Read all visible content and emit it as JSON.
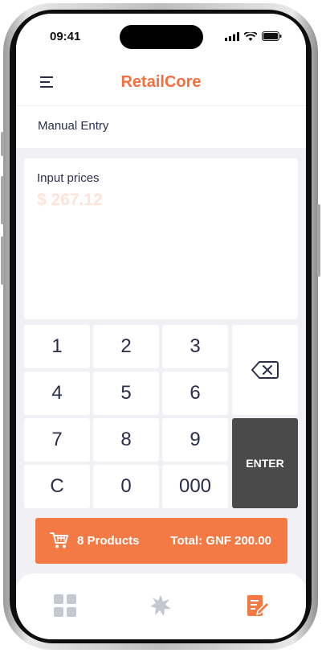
{
  "status_bar": {
    "time": "09:41"
  },
  "header": {
    "app_title": "RetailCore",
    "menu_icon": "hamburger-menu-icon"
  },
  "section": {
    "title": "Manual Entry"
  },
  "price_input": {
    "label": "Input prices",
    "placeholder": "$ 267.12"
  },
  "keypad": {
    "keys": [
      "1",
      "2",
      "3",
      "4",
      "5",
      "6",
      "7",
      "8",
      "9",
      "C",
      "0",
      "000"
    ],
    "backspace_icon": "backspace-icon",
    "enter_label": "ENTER"
  },
  "cart": {
    "icon": "cart-icon",
    "count_label": "8 Products",
    "total_label": "Total: GNF 200.00"
  },
  "tabs": [
    {
      "icon": "grid-icon",
      "active": false
    },
    {
      "icon": "star-burst-icon",
      "active": false
    },
    {
      "icon": "edit-document-icon",
      "active": true
    }
  ],
  "colors": {
    "accent": "#f26f3f",
    "cart_bar": "#f47a45",
    "enter_key": "#4a4a4a",
    "text": "#2b2d4a"
  }
}
